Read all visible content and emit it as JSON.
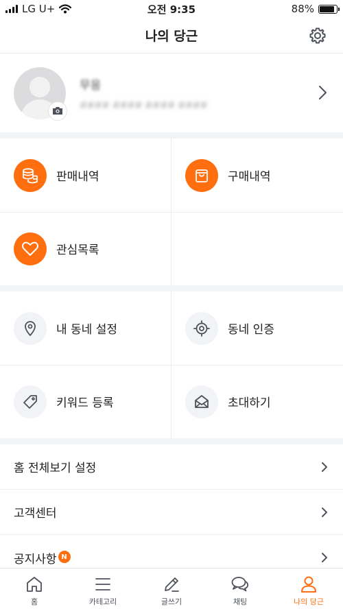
{
  "status_bar": {
    "carrier": "LG U+",
    "time": "오전 9:35",
    "battery": "88%",
    "battery_level": 0.88
  },
  "header": {
    "title": "나의 당근"
  },
  "profile": {
    "name": "무응",
    "sub": "#### #### #### ####"
  },
  "colors": {
    "accent": "#ff6f0f",
    "divider": "#f2f3f6",
    "text": "#212124"
  },
  "menu_primary": [
    {
      "label": "판매내역",
      "icon": "coins-icon"
    },
    {
      "label": "구매내역",
      "icon": "shopping-bag-icon"
    },
    {
      "label": "관심목록",
      "icon": "heart-icon"
    }
  ],
  "menu_secondary": [
    {
      "label": "내 동네 설정",
      "icon": "location-pin-icon"
    },
    {
      "label": "동네 인증",
      "icon": "target-icon"
    },
    {
      "label": "키워드 등록",
      "icon": "tag-icon"
    },
    {
      "label": "초대하기",
      "icon": "envelope-icon"
    }
  ],
  "list": [
    {
      "label": "홈 전체보기 설정"
    },
    {
      "label": "고객센터"
    },
    {
      "label": "공지사항",
      "badge": "N"
    }
  ],
  "tabs": [
    {
      "label": "홈",
      "icon": "home-icon"
    },
    {
      "label": "카테고리",
      "icon": "menu-icon"
    },
    {
      "label": "글쓰기",
      "icon": "pencil-icon"
    },
    {
      "label": "채팅",
      "icon": "chat-icon"
    },
    {
      "label": "나의 당근",
      "icon": "person-icon",
      "active": true
    }
  ]
}
